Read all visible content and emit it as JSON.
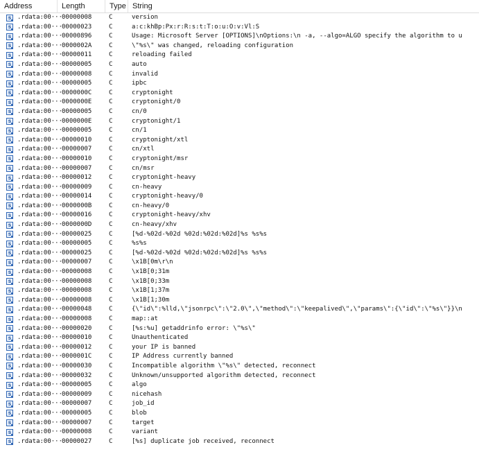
{
  "columns": {
    "address": "Address",
    "length": "Length",
    "type": "Type",
    "string": "String"
  },
  "icon": {
    "glyph": "s",
    "name": "string-icon"
  },
  "rows": [
    {
      "address": ".rdata:00···",
      "length": "00000008",
      "type": "C",
      "string": "version"
    },
    {
      "address": ".rdata:00···",
      "length": "00000023",
      "type": "C",
      "string": "a:c:khBp:Px:r:R:s:t:T:o:u:O:v:Vl:S"
    },
    {
      "address": ".rdata:00···",
      "length": "00000896",
      "type": "C",
      "string": "Usage: Microsoft Server [OPTIONS]\\nOptions:\\n  -a, --algo=ALGO          specify the algorithm to u"
    },
    {
      "address": ".rdata:00···",
      "length": "0000002A",
      "type": "C",
      "string": "\\\"%s\\\" was changed, reloading configuration"
    },
    {
      "address": ".rdata:00···",
      "length": "00000011",
      "type": "C",
      "string": "reloading failed"
    },
    {
      "address": ".rdata:00···",
      "length": "00000005",
      "type": "C",
      "string": "auto"
    },
    {
      "address": ".rdata:00···",
      "length": "00000008",
      "type": "C",
      "string": "invalid"
    },
    {
      "address": ".rdata:00···",
      "length": "00000005",
      "type": "C",
      "string": "ipbc"
    },
    {
      "address": ".rdata:00···",
      "length": "0000000C",
      "type": "C",
      "string": "cryptonight"
    },
    {
      "address": ".rdata:00···",
      "length": "0000000E",
      "type": "C",
      "string": "cryptonight/0"
    },
    {
      "address": ".rdata:00···",
      "length": "00000005",
      "type": "C",
      "string": "cn/0"
    },
    {
      "address": ".rdata:00···",
      "length": "0000000E",
      "type": "C",
      "string": "cryptonight/1"
    },
    {
      "address": ".rdata:00···",
      "length": "00000005",
      "type": "C",
      "string": "cn/1"
    },
    {
      "address": ".rdata:00···",
      "length": "00000010",
      "type": "C",
      "string": "cryptonight/xtl"
    },
    {
      "address": ".rdata:00···",
      "length": "00000007",
      "type": "C",
      "string": "cn/xtl"
    },
    {
      "address": ".rdata:00···",
      "length": "00000010",
      "type": "C",
      "string": "cryptonight/msr"
    },
    {
      "address": ".rdata:00···",
      "length": "00000007",
      "type": "C",
      "string": "cn/msr"
    },
    {
      "address": ".rdata:00···",
      "length": "00000012",
      "type": "C",
      "string": "cryptonight-heavy"
    },
    {
      "address": ".rdata:00···",
      "length": "00000009",
      "type": "C",
      "string": "cn-heavy"
    },
    {
      "address": ".rdata:00···",
      "length": "00000014",
      "type": "C",
      "string": "cryptonight-heavy/0"
    },
    {
      "address": ".rdata:00···",
      "length": "0000000B",
      "type": "C",
      "string": "cn-heavy/0"
    },
    {
      "address": ".rdata:00···",
      "length": "00000016",
      "type": "C",
      "string": "cryptonight-heavy/xhv"
    },
    {
      "address": ".rdata:00···",
      "length": "0000000D",
      "type": "C",
      "string": "cn-heavy/xhv"
    },
    {
      "address": ".rdata:00···",
      "length": "00000025",
      "type": "C",
      "string": "[%d-%02d-%02d %02d:%02d:%02d]%s %s%s"
    },
    {
      "address": ".rdata:00···",
      "length": "00000005",
      "type": "C",
      "string": "%s%s"
    },
    {
      "address": ".rdata:00···",
      "length": "00000025",
      "type": "C",
      "string": "[%d-%02d-%02d %02d:%02d:%02d]%s %s%s"
    },
    {
      "address": ".rdata:00···",
      "length": "00000007",
      "type": "C",
      "string": "\\x1B[0m\\r\\n"
    },
    {
      "address": ".rdata:00···",
      "length": "00000008",
      "type": "C",
      "string": "\\x1B[0;31m"
    },
    {
      "address": ".rdata:00···",
      "length": "00000008",
      "type": "C",
      "string": "\\x1B[0;33m"
    },
    {
      "address": ".rdata:00···",
      "length": "00000008",
      "type": "C",
      "string": "\\x1B[1;37m"
    },
    {
      "address": ".rdata:00···",
      "length": "00000008",
      "type": "C",
      "string": "\\x1B[1;30m"
    },
    {
      "address": ".rdata:00···",
      "length": "00000048",
      "type": "C",
      "string": "{\\\"id\\\":%lld,\\\"jsonrpc\\\":\\\"2.0\\\",\\\"method\\\":\\\"keepalived\\\",\\\"params\\\":{\\\"id\\\":\\\"%s\\\"}}\\n"
    },
    {
      "address": ".rdata:00···",
      "length": "00000008",
      "type": "C",
      "string": "map::at"
    },
    {
      "address": ".rdata:00···",
      "length": "00000020",
      "type": "C",
      "string": "[%s:%u] getaddrinfo error: \\\"%s\\\""
    },
    {
      "address": ".rdata:00···",
      "length": "00000010",
      "type": "C",
      "string": "Unauthenticated"
    },
    {
      "address": ".rdata:00···",
      "length": "00000012",
      "type": "C",
      "string": "your IP is banned"
    },
    {
      "address": ".rdata:00···",
      "length": "0000001C",
      "type": "C",
      "string": "IP Address currently banned"
    },
    {
      "address": ".rdata:00···",
      "length": "00000030",
      "type": "C",
      "string": "Incompatible algorithm \\\"%s\\\" detected, reconnect"
    },
    {
      "address": ".rdata:00···",
      "length": "00000032",
      "type": "C",
      "string": "Unknown/unsupported algorithm detected, reconnect"
    },
    {
      "address": ".rdata:00···",
      "length": "00000005",
      "type": "C",
      "string": "algo"
    },
    {
      "address": ".rdata:00···",
      "length": "00000009",
      "type": "C",
      "string": "nicehash"
    },
    {
      "address": ".rdata:00···",
      "length": "00000007",
      "type": "C",
      "string": "job_id"
    },
    {
      "address": ".rdata:00···",
      "length": "00000005",
      "type": "C",
      "string": "blob"
    },
    {
      "address": ".rdata:00···",
      "length": "00000007",
      "type": "C",
      "string": "target"
    },
    {
      "address": ".rdata:00···",
      "length": "00000008",
      "type": "C",
      "string": "variant"
    },
    {
      "address": ".rdata:00···",
      "length": "00000027",
      "type": "C",
      "string": "[%s] duplicate job received, reconnect"
    }
  ]
}
